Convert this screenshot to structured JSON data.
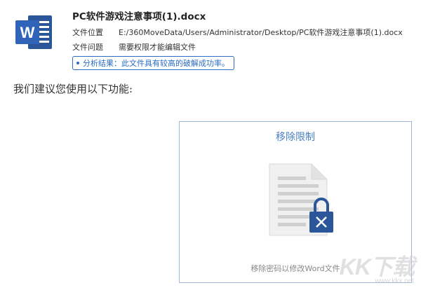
{
  "file": {
    "name": "PC软件游戏注意事项(1).docx",
    "location_label": "文件位置",
    "location_value": "E:/360MoveData/Users/Administrator/Desktop/PC软件游戏注意事项(1).docx",
    "issue_label": "文件问题",
    "issue_value": "需要权限才能编辑文件",
    "result_text": "分析结果：此文件具有较高的破解成功率。",
    "icon": "word-doc-icon"
  },
  "recommend_text": "我们建议您使用以下功能:",
  "card": {
    "title": "移除限制",
    "description": "移除密码以修改Word文件",
    "icon": "locked-document-icon"
  },
  "watermark": {
    "logo": "KK下载",
    "url": "www.kkx.net"
  },
  "colors": {
    "accent": "#2b6cc4",
    "card_border": "#9fb8e0",
    "word_blue": "#2b579a"
  }
}
